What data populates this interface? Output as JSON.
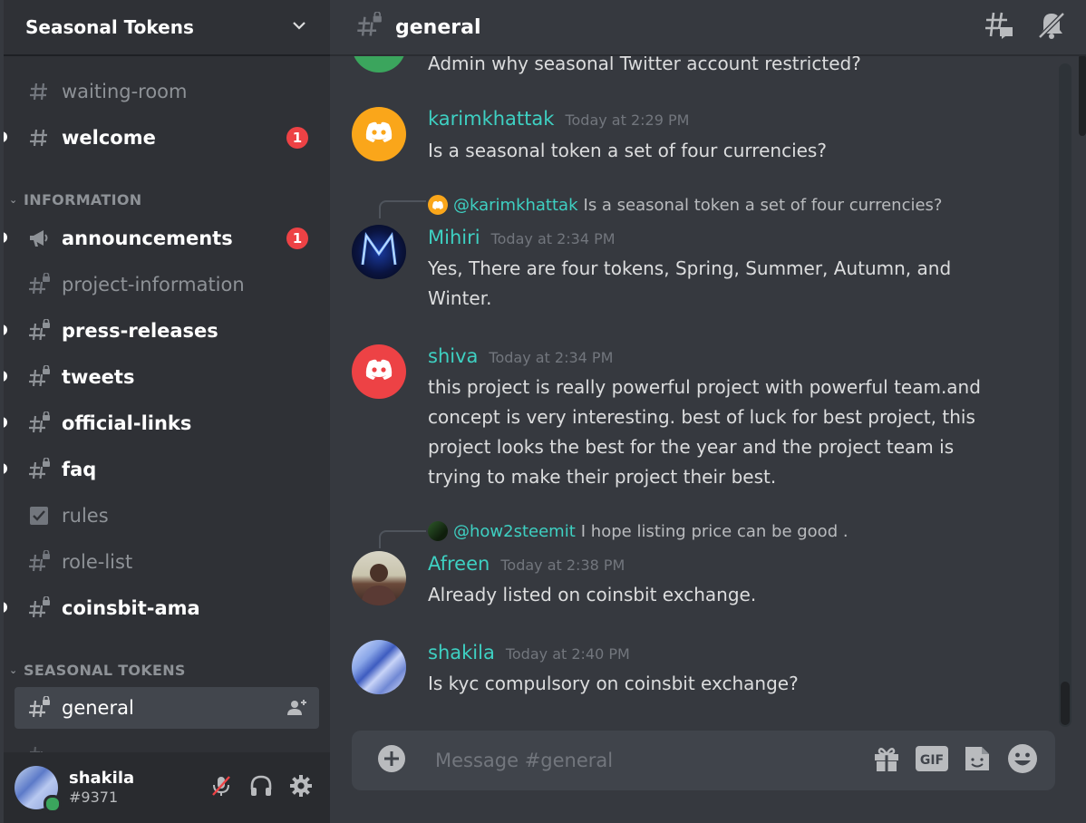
{
  "server": {
    "name": "Seasonal Tokens"
  },
  "sidebar": {
    "channels_top": [
      {
        "label": "waiting-room",
        "unread": false
      },
      {
        "label": "welcome",
        "unread": true,
        "badge": "1"
      }
    ],
    "categories": [
      {
        "label": "INFORMATION"
      },
      {
        "label": "SEASONAL TOKENS"
      }
    ],
    "info_channels": [
      {
        "label": "announcements",
        "unread": true,
        "badge": "1"
      },
      {
        "label": "project-information",
        "unread": false
      },
      {
        "label": "press-releases",
        "unread": true
      },
      {
        "label": "tweets",
        "unread": true
      },
      {
        "label": "official-links",
        "unread": true
      },
      {
        "label": "faq",
        "unread": true
      },
      {
        "label": "rules",
        "unread": false
      },
      {
        "label": "role-list",
        "unread": false
      },
      {
        "label": "coinsbit-ama",
        "unread": true
      }
    ],
    "seasonal_channels": [
      {
        "label": "general",
        "selected": true
      }
    ]
  },
  "user": {
    "name": "shakila",
    "tag": "#9371"
  },
  "topbar": {
    "channel": "general"
  },
  "messages": [
    {
      "text": "Admin why seasonal Twitter account restricted?"
    },
    {
      "user": "karimkhattak",
      "time": "Today at 2:29 PM",
      "text": "Is a seasonal token a set of four currencies?"
    },
    {
      "reply_to": "@karimkhattak",
      "reply_text": "Is a seasonal token a set of four currencies?",
      "user": "Mihiri",
      "time": "Today at 2:34 PM",
      "text": "Yes, There are four tokens, Spring, Summer, Autumn, and Winter."
    },
    {
      "user": "shiva",
      "time": "Today at 2:34 PM",
      "text": "this project is really powerful project with powerful team.and concept is very interesting. best of luck for best project, this project looks the best for the year and the project team is trying to make their project their best."
    },
    {
      "reply_to": "@how2steemit",
      "reply_text": "I hope listing price can be good .",
      "user": "Afreen",
      "time": "Today at 2:38 PM",
      "text": "Already listed on coinsbit exchange."
    },
    {
      "user": "shakila",
      "time": "Today at 2:40 PM",
      "text": "Is kyc compulsory on coinsbit exchange?"
    }
  ],
  "composer": {
    "placeholder": "Message #general"
  },
  "colors": {
    "accent": "#3ed0c2",
    "badge": "#ed4245",
    "online": "#3ba55d"
  }
}
